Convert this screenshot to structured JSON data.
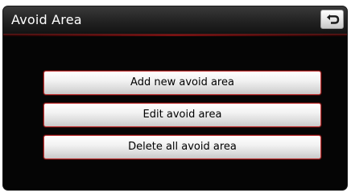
{
  "header": {
    "title": "Avoid Area",
    "back_icon": "back-arrow-icon"
  },
  "menu": {
    "items": [
      {
        "label": "Add new avoid area"
      },
      {
        "label": "Edit avoid area"
      },
      {
        "label": "Delete all avoid area"
      }
    ]
  },
  "colors": {
    "background": "#050505",
    "button_border": "#c23a3a",
    "title_text": "#ffffff"
  }
}
